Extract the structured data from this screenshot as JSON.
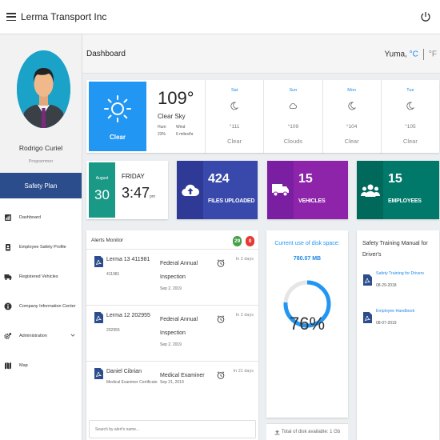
{
  "app": {
    "title": "Lerma Transport Inc"
  },
  "user": {
    "name": "Rodrigo Curiel",
    "role": "Programmer"
  },
  "sidebar": {
    "header": "Safety Plan",
    "items": [
      {
        "label": "Dashboard",
        "icon": "dashboard-icon"
      },
      {
        "label": "Employee Safety Profile",
        "icon": "badge-icon"
      },
      {
        "label": "Registered Vehicles",
        "icon": "truck-icon"
      },
      {
        "label": "Company Information Center",
        "icon": "info-icon"
      },
      {
        "label": "Administration",
        "icon": "gears-icon"
      },
      {
        "label": "Map",
        "icon": "map-icon"
      }
    ]
  },
  "page": {
    "title": "Dashboard"
  },
  "weather": {
    "location": "Yuma,",
    "unit_c": "°C",
    "unit_f": "°F",
    "today": {
      "condition": "Clear",
      "temp": "109°",
      "sky": "Clear Sky",
      "hum_label": "Hum",
      "wind_label": "Wind",
      "hum": "23%",
      "wind": "6 miles/hr"
    },
    "forecast": [
      {
        "day": "Sat",
        "temp": "°111",
        "desc": "Clear",
        "icon": "clear-night-icon"
      },
      {
        "day": "Sun",
        "temp": "°109",
        "desc": "Clouds",
        "icon": "cloud-icon"
      },
      {
        "day": "Mon",
        "temp": "°104",
        "desc": "Clear",
        "icon": "clear-night-icon"
      },
      {
        "day": "Tue",
        "temp": "°105",
        "desc": "Clear",
        "icon": "clear-night-icon"
      }
    ]
  },
  "datecard": {
    "month": "August",
    "day": "30",
    "weekday": "FRIDAY",
    "time": "3:47",
    "ampm": "pm"
  },
  "stats": {
    "files": {
      "value": "424",
      "label": "FILES UPLOADED"
    },
    "vehicles": {
      "value": "15",
      "label": "VEHICLES"
    },
    "employees": {
      "value": "15",
      "label": "EMPLOYEES"
    }
  },
  "colors": {
    "files": "#3949ab",
    "vehicles": "#8e24aa",
    "employees": "#00796b",
    "date": "#1a9987",
    "sidebar_header": "#2b4d8c",
    "accent": "#2196f3"
  },
  "alerts": {
    "title": "Alerts Monitor",
    "badge_green": "29",
    "badge_red": "0",
    "search_placeholder": "Search by alert's name...",
    "rows": [
      {
        "name": "Lerma 13 411981",
        "id": "411981",
        "type": "Federal Annual Inspection",
        "date": "Sep 2, 2019",
        "due": "In 2 days"
      },
      {
        "name": "Lerma 12 202955",
        "id": "202955",
        "type": "Federal Annual Inspection",
        "date": "Sep 2, 2019",
        "due": "In 2 days"
      },
      {
        "name": "Daniel Cibrian",
        "id": "Medical Examiner Certificate",
        "type": "Medical Examiner",
        "date": "Sep 21, 2019",
        "due": "In 21 days"
      }
    ]
  },
  "disk": {
    "title": "Current use of disk space:",
    "used": "780.07 MB",
    "percent_label": "76%",
    "percent": 76,
    "footer": "Total of disk available: 1 Gb"
  },
  "training": {
    "title": "Safety Training Manual for Driver's",
    "docs": [
      {
        "name": "Safety Training for Drivers",
        "date": "08-29-2018"
      },
      {
        "name": "Employee Handbook",
        "date": "08-07-2019"
      }
    ]
  }
}
